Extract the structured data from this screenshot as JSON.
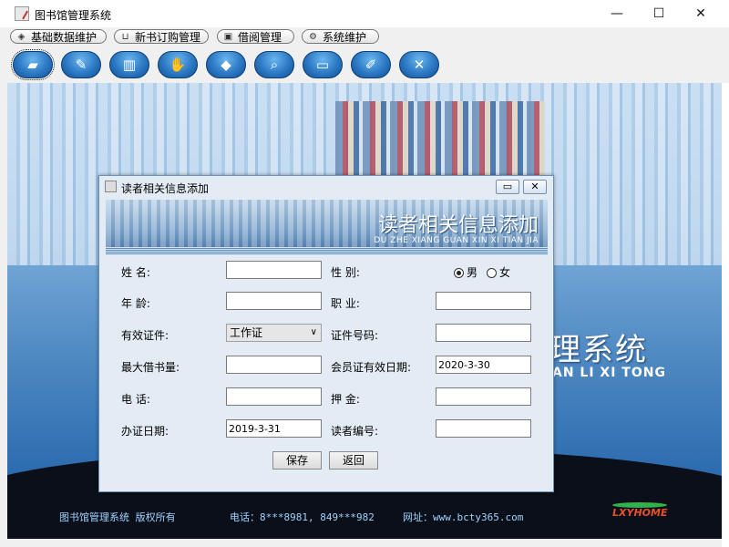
{
  "window": {
    "title": "图书馆管理系统",
    "minimize_label": "—",
    "maximize_label": "☐",
    "close_label": "✕"
  },
  "menus": [
    {
      "label": "基础数据维护",
      "icon": "cube-icon"
    },
    {
      "label": "新书订购管理",
      "icon": "cart-icon"
    },
    {
      "label": "借阅管理",
      "icon": "lock-icon"
    },
    {
      "label": "系统维护",
      "icon": "gears-icon"
    }
  ],
  "toolbar": [
    "book-icon",
    "pen-icon",
    "books-icon",
    "hand-icon",
    "boxes-icon",
    "magnifier-icon",
    "monitor-icon",
    "edit-icon",
    "tools-icon"
  ],
  "background": {
    "title": "理系统",
    "subtitle": "AN LI XI TONG",
    "footer_name": "图书馆管理系统  版权所有",
    "footer_phone": "电话：8***8981, 849***982",
    "footer_site": "网址：www.bcty365.com",
    "logo": "LXYHOME"
  },
  "dialog": {
    "title": "读者相关信息添加",
    "banner_title": "读者相关信息添加",
    "banner_sub": "DU ZHE XIANG GUAN XIN XI TIAN JIA",
    "min_label": "▭",
    "close_label": "✕",
    "labels": {
      "name": "姓    名:",
      "gender": "性    别:",
      "age": "年    龄:",
      "job": "职    业:",
      "id_type": "有效证件:",
      "id_number": "证件号码:",
      "max_borrow": "最大借书量:",
      "member_valid": "会员证有效日期:",
      "phone": "电    话:",
      "deposit": "押    金:",
      "issue_date": "办证日期:",
      "reader_no": "读者编号:"
    },
    "values": {
      "name": "",
      "age": "",
      "job": "",
      "id_type": "工作证",
      "id_number": "",
      "max_borrow": "",
      "member_valid": "2020-3-30",
      "phone": "",
      "deposit": "",
      "issue_date": "2019-3-31",
      "reader_no": ""
    },
    "gender_male": "男",
    "gender_female": "女",
    "gender_selected": "男",
    "save_label": "保存",
    "back_label": "返回"
  }
}
